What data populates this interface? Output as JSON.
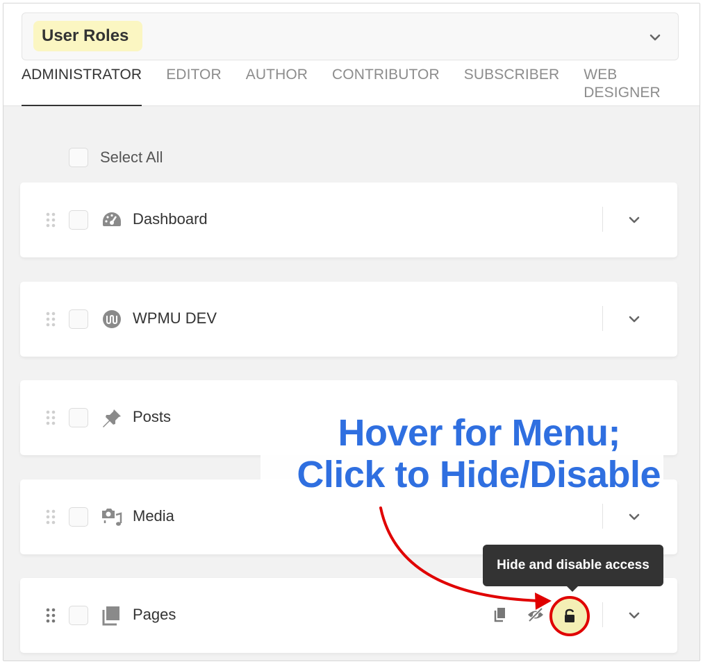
{
  "role_select": {
    "label": "User Roles",
    "icon": "chevron-down-icon"
  },
  "tabs": [
    {
      "label": "ADMINISTRATOR",
      "active": true
    },
    {
      "label": "EDITOR",
      "active": false
    },
    {
      "label": "AUTHOR",
      "active": false
    },
    {
      "label": "CONTRIBUTOR",
      "active": false
    },
    {
      "label": "SUBSCRIBER",
      "active": false
    },
    {
      "label": "WEB DESIGNER",
      "active": false
    }
  ],
  "select_all": {
    "label": "Select All"
  },
  "menu_items": [
    {
      "label": "Dashboard",
      "icon": "dashboard-gauge-icon"
    },
    {
      "label": "WPMU DEV",
      "icon": "wpmu-dev-logo-icon"
    },
    {
      "label": "Posts",
      "icon": "pushpin-icon"
    },
    {
      "label": "Media",
      "icon": "media-camera-music-icon"
    },
    {
      "label": "Pages",
      "icon": "pages-icon",
      "actions": [
        "duplicate-icon",
        "hidden-eye-icon",
        "unlock-icon"
      ]
    }
  ],
  "tooltip": {
    "text": "Hide and disable access"
  },
  "callout": {
    "line1": "Hover for Menu;",
    "line2": "Click to Hide/Disable"
  },
  "colors": {
    "accent_callout": "#2f6fe0",
    "highlight": "#fbf6c2",
    "arrow": "#e00000",
    "tooltip_bg": "#333333"
  }
}
